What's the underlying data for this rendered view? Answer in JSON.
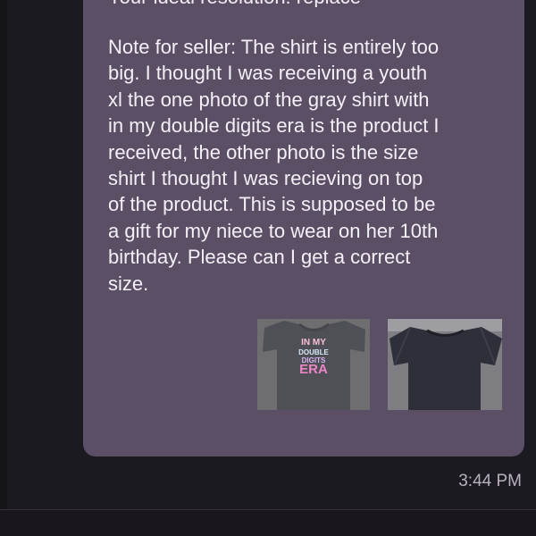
{
  "message": {
    "resolution_line": "Your ideal resolution: replace",
    "note_lines": [
      "Note for seller: The shirt is entirely too",
      "big. I thought I was receiving a youth",
      "xl the one photo of the gray shirt with",
      "in my double digits era is the product I",
      "received, the other photo is the size",
      "shirt I thought I was recieving on top",
      "of the product. This is supposed to be",
      "a gift for my niece to wear on her 10th",
      "birthday. Please can I get a correct",
      "size."
    ],
    "timestamp": "3:44 PM",
    "attachments": [
      {
        "icon": "photo-gray-shirt",
        "print_text": "ERA"
      },
      {
        "icon": "photo-black-shirt"
      }
    ]
  },
  "colors": {
    "background": "#1c1a21",
    "bubble": "#5b4f65",
    "text": "#f4f0f7",
    "timestamp": "#b8b1bd"
  }
}
